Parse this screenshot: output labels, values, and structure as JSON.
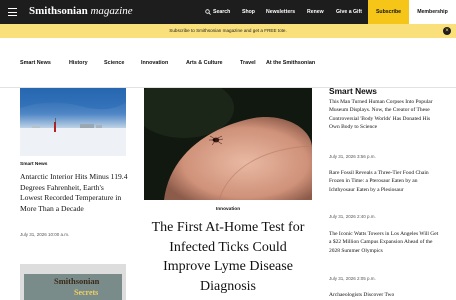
{
  "header": {
    "logo_main": "Smithsonian",
    "logo_italic": "magazine",
    "nav": [
      "Search",
      "Shop",
      "Newsletters",
      "Renew",
      "Give a Gift"
    ],
    "subscribe": "Subscribe",
    "membership": "Membership",
    "colors": {
      "bar": "#1d1d1d",
      "subscribe": "#f5c518",
      "membership": "#ffffff"
    }
  },
  "promo": {
    "text": "Subscribe to Smithsonian magazine and get a FREE tote.",
    "color": "#f9e07a"
  },
  "sections": [
    "Smart News",
    "History",
    "Science",
    "Innovation",
    "Arts & Culture",
    "Travel",
    "At the Smithsonian"
  ],
  "left_article": {
    "kicker": "Smart News",
    "title": "Antarctic Interior Hits Minus 119.4 Degrees Fahrenheit, Earth's Lowest Recorded Temperature in More Than a Decade",
    "date": "July 31, 2026 10:00 a.m."
  },
  "magazine_cover": {
    "title": "Smithsonian",
    "subtitle": "Secrets"
  },
  "featured_article": {
    "kicker": "Innovation",
    "title": "The First At-Home Test for Infected Ticks Could Improve Lyme Disease Diagnosis"
  },
  "smart_news": {
    "heading": "Smart News",
    "items": [
      {
        "title": "This Man Turned Human Corpses Into Popular Museum Displays. Now, the Creator of These Controversial 'Body Worlds' Has Donated His Own Body to Science",
        "date": "July 31, 2026 3:56 p.m."
      },
      {
        "title": "Rare Fossil Reveals a Three-Tier Food Chain Frozen in Time: a Pterosaur Eaten by an Ichthyosaur Eaten by a Plesiosaur",
        "date": "July 31, 2026 2:40 p.m."
      },
      {
        "title": "The Iconic Watts Towers in Los Angeles Will Get a $22 Million Campus Expansion Ahead of the 2028 Summer Olympics",
        "date": "July 31, 2026 2:05 p.m."
      },
      {
        "title": "Archaeologists Discover Two",
        "date": ""
      }
    ]
  }
}
